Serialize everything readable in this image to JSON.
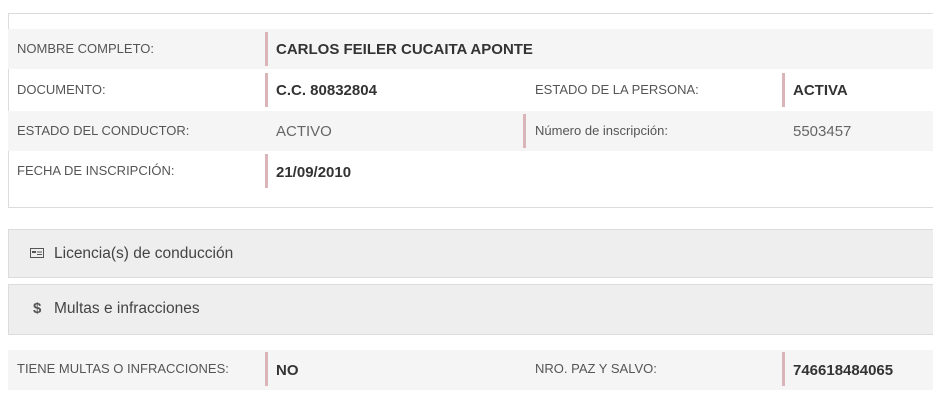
{
  "person": {
    "nombre_label": "NOMBRE COMPLETO:",
    "nombre_value": "CARLOS FEILER CUCAITA APONTE",
    "documento_label": "DOCUMENTO:",
    "documento_value": "C.C. 80832804",
    "estado_persona_label": "ESTADO DE LA PERSONA:",
    "estado_persona_value": "ACTIVA",
    "estado_conductor_label": "ESTADO DEL CONDUCTOR:",
    "estado_conductor_value": "ACTIVO",
    "inscripcion_num_label": "Número de inscripción:",
    "inscripcion_num_value": "5503457",
    "fecha_label": "FECHA DE INSCRIPCIÓN:",
    "fecha_value": "21/09/2010"
  },
  "sections": {
    "licencias_icon": "id-card-icon",
    "licencias_title": "Licencia(s) de conducción",
    "multas_icon_glyph": "$",
    "multas_title": "Multas e infracciones"
  },
  "multas": {
    "tiene_label": "TIENE MULTAS O INFRACCIONES:",
    "tiene_value": "NO",
    "paz_label": "NRO. PAZ Y SALVO:",
    "paz_value": "746618484065"
  },
  "colors": {
    "accent_bar": "#d9b4b8",
    "row_gray": "#f5f5f5",
    "section_gray": "#eeeeee"
  }
}
